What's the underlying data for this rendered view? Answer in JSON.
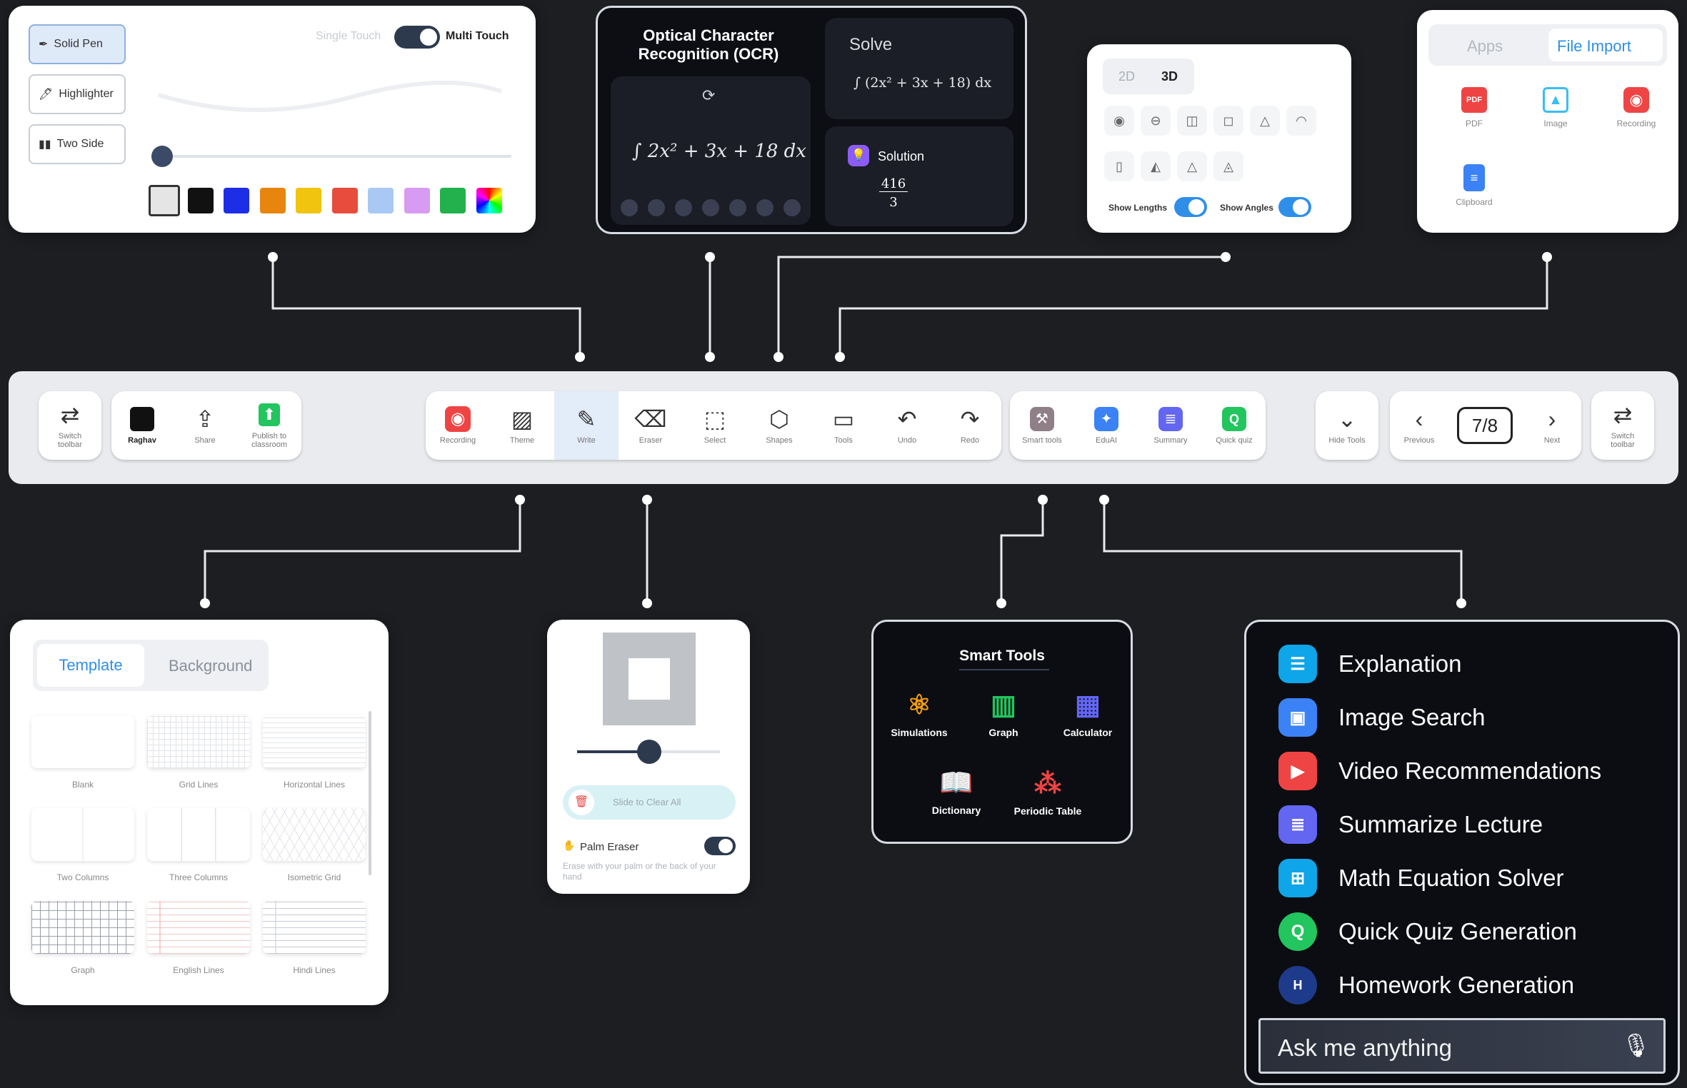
{
  "pen_panel": {
    "options": [
      "Solid Pen",
      "Highlighter",
      "Two Side"
    ],
    "single_touch": "Single Touch",
    "multi_touch": "Multi Touch",
    "colors": [
      "#e5e5e5",
      "#111111",
      "#1e2ee6",
      "#e8850e",
      "#f1c40f",
      "#e74c3c",
      "#a9c8f4",
      "#d79bf3",
      "#22b14c",
      "rainbow"
    ]
  },
  "ocr_panel": {
    "title": "Optical Character Recognition (OCR)",
    "handwriting": "∫ 2x² + 3x + 18 dx",
    "solve_title": "Solve",
    "solve_expr": "∫ (2x² + 3x + 18) dx",
    "solution_label": "Solution",
    "solution_num": "416",
    "solution_den": "3"
  },
  "shapes_panel": {
    "tabs": [
      "2D",
      "3D"
    ],
    "show_lengths": "Show Lengths",
    "show_angles": "Show Angles"
  },
  "import_panel": {
    "tabs": [
      "Apps",
      "File Import"
    ],
    "items": [
      "PDF",
      "Image",
      "Recording",
      "Clipboard"
    ]
  },
  "toolbar": {
    "left": [
      "Switch toolbar",
      "Raghav",
      "Share",
      "Publish to classroom"
    ],
    "main": [
      "Recording",
      "Theme",
      "Write",
      "Eraser",
      "Select",
      "Shapes",
      "Tools",
      "Undo",
      "Redo"
    ],
    "smart": [
      "Smart tools",
      "EduAI",
      "Summary",
      "Quick quiz"
    ],
    "right": [
      "Hide Tools",
      "Previous",
      "Next",
      "Switch toolbar"
    ],
    "page": "7/8"
  },
  "template_panel": {
    "tabs": [
      "Template",
      "Background"
    ],
    "items": [
      "Blank",
      "Grid Lines",
      "Horizontal Lines",
      "Two Columns",
      "Three Columns",
      "Isometric Grid",
      "Graph",
      "English Lines",
      "Hindi Lines"
    ]
  },
  "eraser_panel": {
    "slide_label": "Slide to Clear All",
    "palm_title": "Palm Eraser",
    "palm_desc": "Erase with your palm or the back of your hand"
  },
  "smart_tools": {
    "title": "Smart Tools",
    "items": [
      "Simulations",
      "Graph",
      "Calculator",
      "Dictionary",
      "Periodic Table"
    ]
  },
  "ai_panel": {
    "items": [
      "Explanation",
      "Image Search",
      "Video Recommendations",
      "Summarize Lecture",
      "Math Equation Solver",
      "Quick Quiz Generation",
      "Homework Generation"
    ],
    "ask_placeholder": "Ask me anything"
  },
  "colors": {
    "background": "#1c1e22",
    "accent_blue": "#2f8fe8",
    "recording_red": "#ef4444"
  }
}
